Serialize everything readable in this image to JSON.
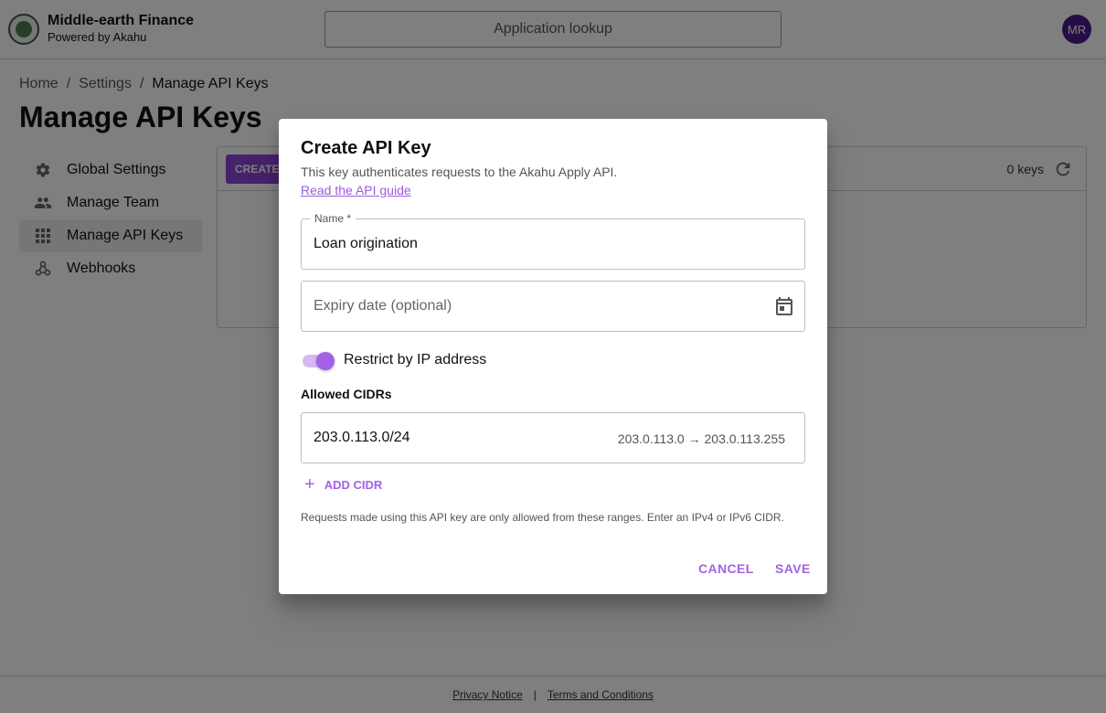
{
  "header": {
    "brand_name": "Middle-earth Finance",
    "brand_sub": "Powered by Akahu",
    "lookup_label": "Application lookup",
    "avatar_initials": "MR"
  },
  "breadcrumb": {
    "items": [
      "Home",
      "Settings",
      "Manage API Keys"
    ],
    "separator": "/"
  },
  "page": {
    "title": "Manage API Keys"
  },
  "sidebar": {
    "items": [
      {
        "label": "Global Settings",
        "icon": "gear-icon"
      },
      {
        "label": "Manage Team",
        "icon": "people-icon"
      },
      {
        "label": "Manage API Keys",
        "icon": "grid-icon",
        "active": true
      },
      {
        "label": "Webhooks",
        "icon": "webhook-icon"
      }
    ]
  },
  "keys_panel": {
    "create_label": "CREATE",
    "count_label": "0 keys"
  },
  "dialog": {
    "title": "Create API Key",
    "description": "This key authenticates requests to the Akahu Apply API.",
    "guide_link": "Read the API guide",
    "name_label": "Name *",
    "name_value": "Loan origination",
    "expiry_placeholder": "Expiry date (optional)",
    "restrict_label": "Restrict by IP address",
    "restrict_enabled": true,
    "cidr_heading": "Allowed CIDRs",
    "cidrs": [
      {
        "value": "203.0.113.0/24",
        "range": "203.0.113.0 → 203.0.113.255"
      }
    ],
    "add_cidr_label": "ADD CIDR",
    "help_text": "Requests made using this API key are only allowed from these ranges. Enter an IPv4 or IPv6 CIDR.",
    "cancel_label": "CANCEL",
    "save_label": "SAVE"
  },
  "footer": {
    "privacy": "Privacy Notice",
    "separator": "|",
    "terms": "Terms and Conditions"
  },
  "colors": {
    "accent": "#a461e6",
    "avatar": "#4a1a8c",
    "create_button": "#8e44d8"
  }
}
